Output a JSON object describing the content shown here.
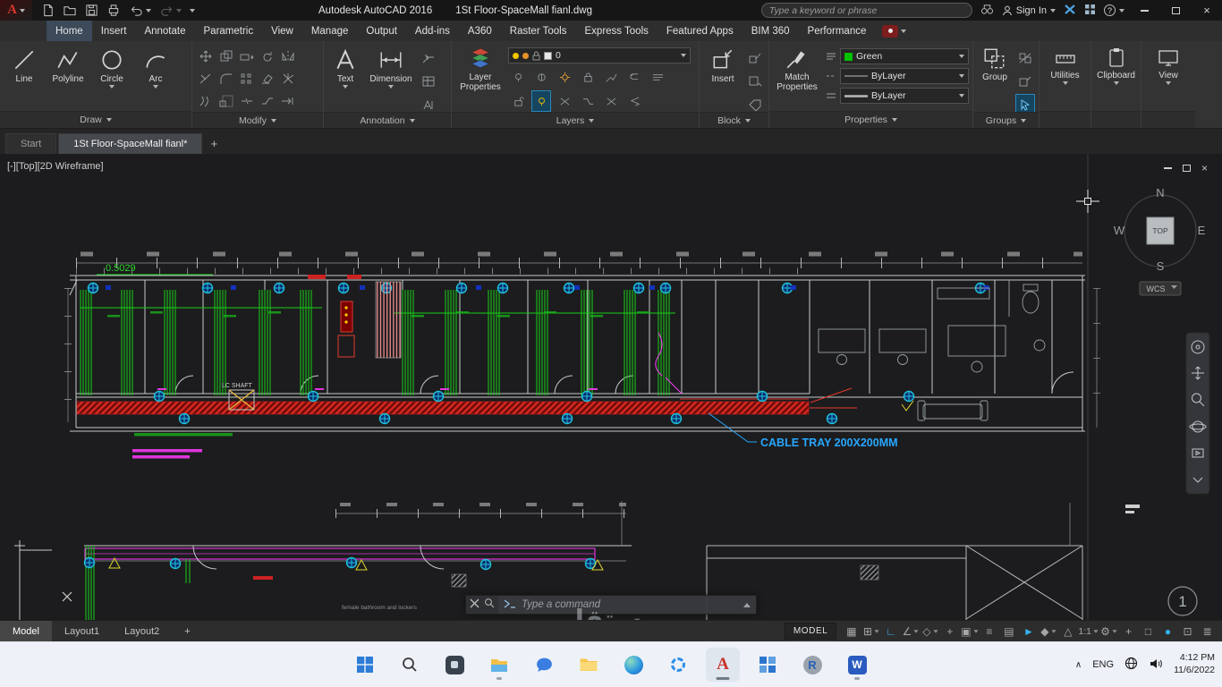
{
  "glyphs": {
    "close": "×",
    "plus": "+",
    "chevron_up": "∧",
    "help": "?"
  },
  "titlebar": {
    "app_title": "Autodesk AutoCAD 2016",
    "doc_title": "1St Floor-SpaceMall fianl.dwg",
    "search_placeholder": "Type a keyword or phrase",
    "sign_in": "Sign In"
  },
  "ribbon": {
    "tabs": [
      "Home",
      "Insert",
      "Annotate",
      "Parametric",
      "View",
      "Manage",
      "Output",
      "Add-ins",
      "A360",
      "Raster Tools",
      "Express Tools",
      "Featured Apps",
      "BIM 360",
      "Performance"
    ],
    "draw": {
      "label": "Draw",
      "line": "Line",
      "polyline": "Polyline",
      "circle": "Circle",
      "arc": "Arc"
    },
    "modify": {
      "label": "Modify"
    },
    "annotation": {
      "label": "Annotation",
      "text": "Text",
      "dimension": "Dimension"
    },
    "layers": {
      "label": "Layers",
      "layer_properties": "Layer Properties",
      "current_layer": "0"
    },
    "block": {
      "label": "Block",
      "insert": "Insert"
    },
    "properties": {
      "label": "Properties",
      "match": "Match Properties",
      "color": "Green",
      "linetype": "ByLayer",
      "lineweight": "ByLayer"
    },
    "groups": {
      "label": "Groups",
      "group": "Group"
    },
    "utilities": "Utilities",
    "clipboard": "Clipboard",
    "view": "View"
  },
  "file_tabs": {
    "start": "Start",
    "doc": "1St Floor-SpaceMall fianl*"
  },
  "viewport": {
    "label": "[-][Top][2D Wireframe]",
    "compass": {
      "n": "N",
      "e": "E",
      "s": "S",
      "w": "W",
      "cube": "TOP",
      "wcs": "WCS"
    },
    "drawing": {
      "dim": "0.5029",
      "cable_tray": "CABLE TRAY 200X200MM",
      "lc_shaft": "LC SHAFT",
      "bathroom_label": "female bathroom and lockers",
      "sheet_no": "1"
    }
  },
  "command_line": {
    "placeholder": "Type a command"
  },
  "status_bar": {
    "model_tab": "Model",
    "layout1": "Layout1",
    "layout2": "Layout2",
    "model_badge": "MODEL",
    "icons": [
      {
        "name": "grid",
        "glyph": "▦"
      },
      {
        "name": "snap-mode",
        "glyph": "⊞"
      },
      {
        "name": "ortho",
        "glyph": "∟"
      },
      {
        "name": "polar-tracking",
        "glyph": "∠"
      },
      {
        "name": "isometric-drafting",
        "glyph": "◇"
      },
      {
        "name": "object-snap-tracking",
        "glyph": "+"
      },
      {
        "name": "object-snap",
        "glyph": "▣"
      },
      {
        "name": "lineweight",
        "glyph": "≡"
      },
      {
        "name": "transparency",
        "glyph": "▤"
      },
      {
        "name": "selection-cycling",
        "glyph": "►"
      },
      {
        "name": "object-snap-3d",
        "glyph": "◆"
      },
      {
        "name": "dynamic-ucs",
        "glyph": "△"
      },
      {
        "name": "annotation-scale",
        "glyph": "1:1"
      },
      {
        "name": "workspace-switching",
        "glyph": "⚙"
      },
      {
        "name": "add",
        "glyph": "+"
      },
      {
        "name": "isolate-objects",
        "glyph": "□"
      },
      {
        "name": "graphics-performance",
        "glyph": "●"
      },
      {
        "name": "clean-screen",
        "glyph": "⊡"
      },
      {
        "name": "customize",
        "glyph": "≣"
      }
    ]
  },
  "taskbar": {
    "lang": "ENG",
    "time": "4:12 PM",
    "date": "11/6/2022",
    "autocad_letter": "A",
    "rstudio_letter": "R",
    "word_letter": "W"
  },
  "watermark": {
    "text": "مستقل"
  },
  "colors": {
    "accent": "#0696d7",
    "tab_active": "#3c4a5a",
    "layer_green": "#00c000",
    "tray_red": "#d62a1e",
    "magenta": "#ff3bff",
    "cyan": "#1fc3dc",
    "cable_text": "#27a7ff"
  }
}
